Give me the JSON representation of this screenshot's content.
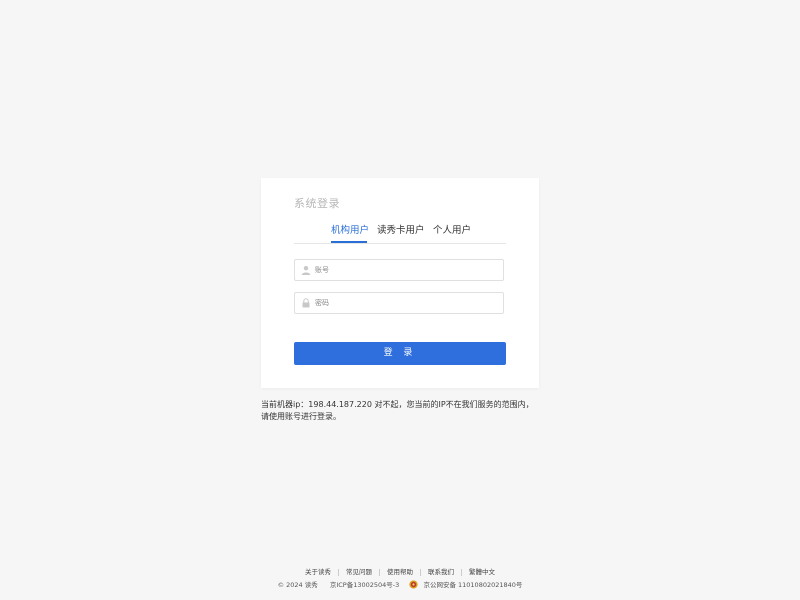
{
  "login": {
    "title": "系统登录",
    "tabs": [
      {
        "label": "机构用户",
        "active": true
      },
      {
        "label": "读秀卡用户",
        "active": false
      },
      {
        "label": "个人用户",
        "active": false
      }
    ],
    "account_placeholder": "账号",
    "password_placeholder": "密码",
    "login_button": "登 录",
    "accent_color": "#2f6fdd"
  },
  "notice": {
    "text": "当前机器ip：198.44.187.220  对不起，您当前的IP不在我们服务的范围内，请使用账号进行登录。"
  },
  "footer": {
    "links": [
      "关于读秀",
      "常见问题",
      "使用帮助",
      "联系我们",
      "繁體中文"
    ],
    "copyright": "© 2024 读秀",
    "icp": "京ICP备13002504号-3",
    "police": "京公网安备 11010802021840号"
  }
}
